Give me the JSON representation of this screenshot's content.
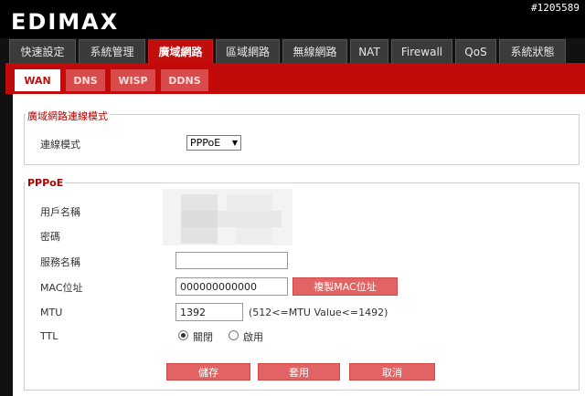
{
  "header": {
    "logo_text": "EDIMAX",
    "badge": "#1205589"
  },
  "main_tabs": [
    {
      "label": "快速設定"
    },
    {
      "label": "系統管理"
    },
    {
      "label": "廣域網路"
    },
    {
      "label": "區域網路"
    },
    {
      "label": "無線網路"
    },
    {
      "label": "NAT"
    },
    {
      "label": "Firewall"
    },
    {
      "label": "QoS"
    },
    {
      "label": "系統狀態"
    }
  ],
  "sub_tabs": [
    {
      "label": "WAN"
    },
    {
      "label": "DNS"
    },
    {
      "label": "WISP"
    },
    {
      "label": "DDNS"
    }
  ],
  "connection_section": {
    "title": "廣域網路連線模式",
    "mode_label": "連線模式",
    "mode_value": "PPPoE"
  },
  "pppoe_section": {
    "title": "PPPoE",
    "username_label": "用戶名稱",
    "password_label": "密碼",
    "service_label": "服務名稱",
    "service_value": "",
    "mac_label": "MAC位址",
    "mac_value": "000000000000",
    "clone_mac_button": "複製MAC位址",
    "mtu_label": "MTU",
    "mtu_value": "1392",
    "mtu_hint": "(512<=MTU Value<=1492)",
    "ttl_label": "TTL",
    "ttl_options": [
      "關閉",
      "啟用"
    ],
    "ttl_selected": "關閉"
  },
  "actions": {
    "save": "儲存",
    "apply": "套用",
    "cancel": "取消"
  },
  "colors": {
    "accent": "#c30a0a",
    "button": "#e26363",
    "header_bg": "#000000"
  }
}
